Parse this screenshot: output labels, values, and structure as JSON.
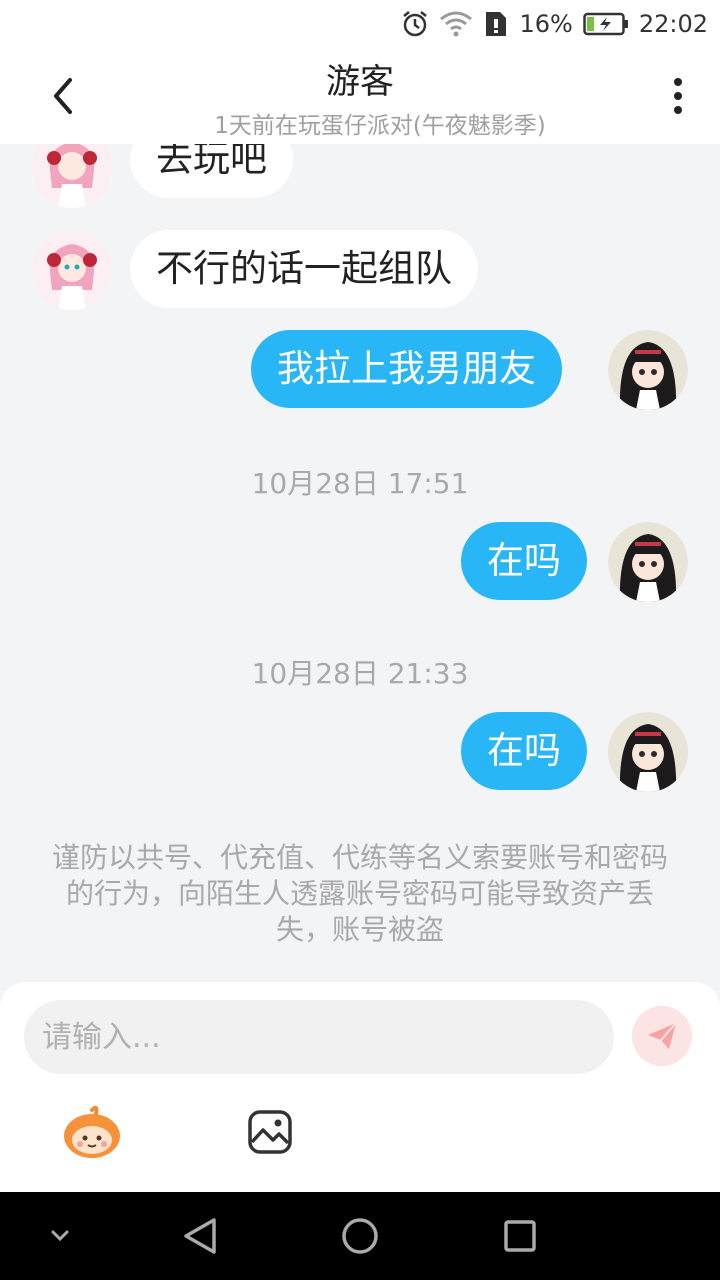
{
  "status_bar": {
    "battery": "16%",
    "time": "22:02"
  },
  "header": {
    "title": "游客",
    "subtitle": "1天前在玩蛋仔派对(午夜魅影季)"
  },
  "messages": [
    {
      "side": "in",
      "text": "去玩吧"
    },
    {
      "side": "in",
      "text": "不行的话一起组队"
    },
    {
      "side": "out",
      "text": "我拉上我男朋友"
    },
    {
      "timestamp": "10月28日 17:51"
    },
    {
      "side": "out",
      "text": "在吗"
    },
    {
      "timestamp": "10月28日 21:33"
    },
    {
      "side": "out",
      "text": "在吗"
    }
  ],
  "notice": "谨防以共号、代充值、代练等名义索要账号和密码的行为，向陌生人透露账号密码可能导致资产丢失，账号被盗",
  "input": {
    "placeholder": "请输入..."
  },
  "colors": {
    "bubble_out": "#29b6f6",
    "bubble_in": "#ffffff",
    "background": "#f3f4f6",
    "send": "#fde4e4"
  },
  "icons": [
    "back-icon",
    "more-icon",
    "alarm-icon",
    "wifi-icon",
    "sim-icon",
    "battery-icon",
    "send-icon",
    "emoji-icon",
    "image-icon",
    "nav-hide-icon",
    "nav-back-icon",
    "nav-home-icon",
    "nav-recents-icon"
  ]
}
